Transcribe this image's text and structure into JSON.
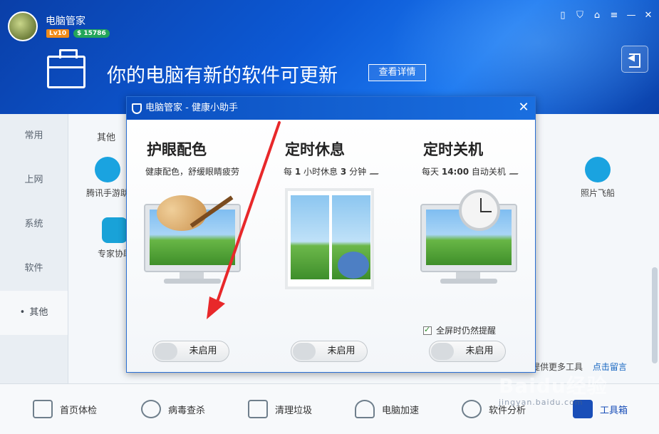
{
  "app": {
    "title": "电脑管家",
    "level_badge": "Lv10",
    "coins_badge": "$ 15786"
  },
  "header": {
    "headline": "你的电脑有新的软件可更新",
    "details_button": "查看详情",
    "window_controls": [
      "phone-icon",
      "shield-icon",
      "shirt-icon",
      "menu-icon",
      "minimize-icon",
      "close-icon"
    ]
  },
  "leftnav": {
    "items": [
      {
        "label": "常用"
      },
      {
        "label": "上网"
      },
      {
        "label": "系统"
      },
      {
        "label": "软件"
      },
      {
        "label": "其他"
      }
    ]
  },
  "main": {
    "section_label": "其他",
    "tools": [
      {
        "label": "腾讯手游助"
      },
      {
        "label": "专家协助"
      },
      {
        "label": "照片飞船"
      }
    ],
    "footer_text": "提供更多工具",
    "footer_link": "点击留言"
  },
  "dialog": {
    "title": "电脑管家 - 健康小助手",
    "features": [
      {
        "title": "护眼配色",
        "desc": "健康配色，舒缓眼睛疲劳",
        "toggle": "未启用"
      },
      {
        "title": "定时休息",
        "desc_parts": [
          "每",
          "1",
          "小时休息",
          "3",
          "分钟"
        ],
        "toggle": "未启用"
      },
      {
        "title": "定时关机",
        "desc_parts": [
          "每天",
          "14:00",
          "自动关机"
        ],
        "checkbox": "全屏时仍然提醒",
        "toggle": "未启用"
      }
    ]
  },
  "bottombar": {
    "items": [
      {
        "label": "首页体检"
      },
      {
        "label": "病毒查杀"
      },
      {
        "label": "清理垃圾"
      },
      {
        "label": "电脑加速"
      },
      {
        "label": "软件分析"
      },
      {
        "label": "工具箱"
      }
    ]
  },
  "watermark": {
    "main": "Baidu经验",
    "sub": "jingyan.baidu.com"
  },
  "colors": {
    "header_blue": "#0d5ad6",
    "dialog_title": "#0b4fc0",
    "arrow_red": "#e8282a",
    "link_blue": "#1565c0"
  }
}
